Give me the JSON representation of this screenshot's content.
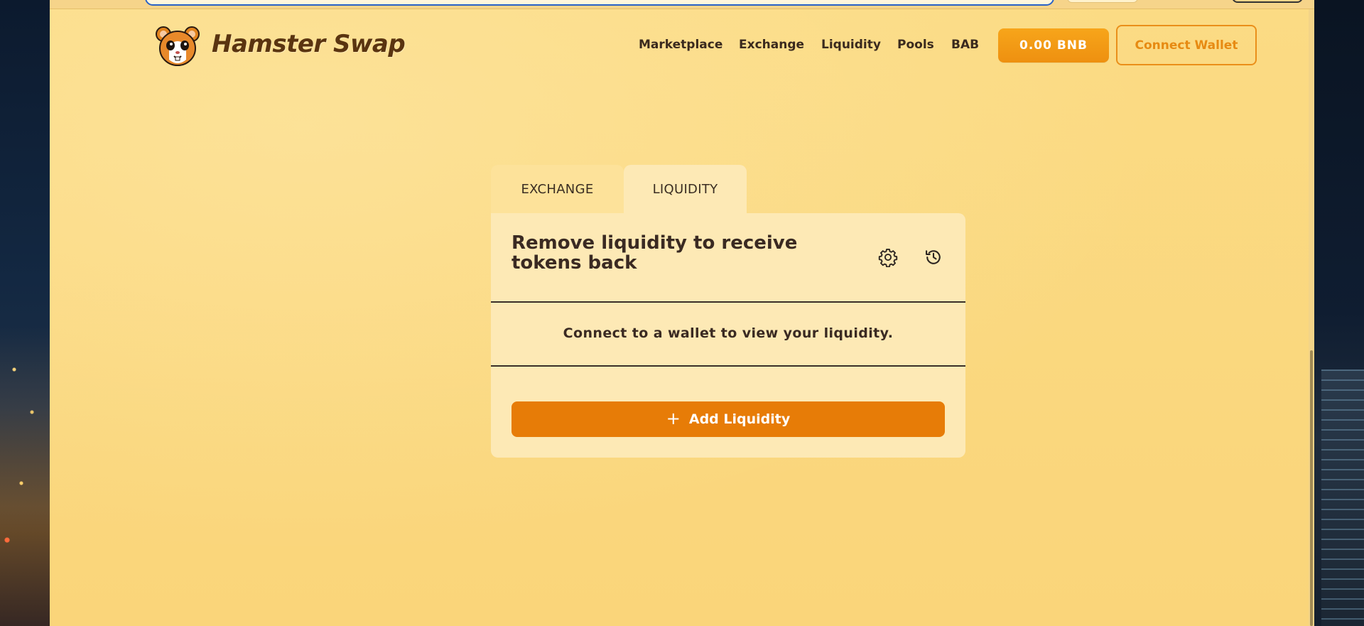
{
  "brand": {
    "name": "Hamster Swap"
  },
  "nav": {
    "items": [
      "Marketplace",
      "Exchange",
      "Liquidity",
      "Pools",
      "BAB"
    ],
    "balance_label": "0.00 BNB",
    "connect_label": "Connect Wallet"
  },
  "tabs": [
    {
      "label": "EXCHANGE",
      "active": false
    },
    {
      "label": "LIQUIDITY",
      "active": true
    }
  ],
  "card": {
    "title": "Remove liquidity to receive tokens back",
    "message": "Connect to a wallet to view your liquidity.",
    "add_button_label": "Add Liquidity",
    "add_button_icon": "plus-icon",
    "settings_icon": "gear-icon",
    "history_icon": "history-icon"
  },
  "colors": {
    "page_bg": "#fad57a",
    "card_bg": "#fde9b5",
    "accent": "#e77c07",
    "bnb_button": "#f59e16",
    "text_dark": "#3a2a22"
  }
}
